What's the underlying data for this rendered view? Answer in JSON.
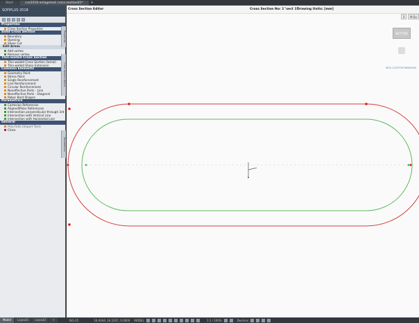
{
  "titlebar": {
    "tabs": [
      {
        "label": "Start"
      },
      {
        "label": "cse2018-anlagemat cross-section01*"
      }
    ],
    "add": "+"
  },
  "sidebar": {
    "app_name": "SOFiPLUS 2018",
    "sections": [
      {
        "title": "Properties",
        "items": [
          {
            "label": "Cross Section Properties"
          }
        ]
      },
      {
        "title": "Solid Cross Section",
        "items": [
          {
            "label": "Boundary"
          },
          {
            "label": "Opening"
          },
          {
            "label": "Shear Cut"
          }
        ]
      },
      {
        "subtitle": "Edit Areas",
        "items": [
          {
            "label": "Add vertex"
          },
          {
            "label": "Remove vertex"
          }
        ]
      },
      {
        "title": "Thin-walled Cross Section",
        "items": [
          {
            "label": "Thin-walled Cross Section (lamel)"
          },
          {
            "label": "Thin-walled Shear Extension"
          }
        ]
      },
      {
        "title": "Common Elements",
        "items": [
          {
            "label": "Geometry Point"
          },
          {
            "label": "Stress Point"
          },
          {
            "label": "Single Reinforcement"
          },
          {
            "label": "Line Reinforcement"
          },
          {
            "label": "Circular Reinforcement"
          },
          {
            "label": "Noneffective Parts - Line"
          },
          {
            "label": "Noneffective Parts - Diagonal"
          },
          {
            "label": "Rebar Bent Shapes"
          }
        ]
      },
      {
        "title": "Parametrics",
        "items": [
          {
            "label": "Cartesian References"
          },
          {
            "label": "Aligned/Polar References"
          },
          {
            "label": "Intersection perpendicular through 3rd"
          },
          {
            "label": "Intersection with Vertical Line"
          },
          {
            "label": "Intersection with Horizontal Line"
          }
        ]
      },
      {
        "title": "General",
        "items": [
          {
            "label": "Poly-Faits (Import Text)"
          },
          {
            "label": "Close"
          }
        ]
      }
    ],
    "vertical_tabs": [
      "Properties",
      "Cross Section Editor",
      "Parametrics"
    ]
  },
  "canvas": {
    "editor_title": "Cross Section Editor",
    "section_no_label": "Cross Section No: 1",
    "section_name": "\"sect 1\"",
    "drawing_units": "Drawing Units: [mm]",
    "nav_cube_label": "BOTTOM",
    "nav_label": "WCS  (CUSTOM WINDOW)",
    "top_buttons": [
      "3",
      "N Qu"
    ],
    "colors": {
      "outer": "#d63c3c",
      "inner": "#5bb95b",
      "points": "#e01d1d"
    }
  },
  "statusbar": {
    "tabs": [
      "Model",
      "Layout1",
      "Layout2"
    ],
    "add": "+",
    "scale": "ISO-25",
    "coords": "16.9344, 16.5207, 0.0000",
    "mode": "MODEL",
    "zoom": "1:1 / 100%",
    "units": "Decimal"
  }
}
